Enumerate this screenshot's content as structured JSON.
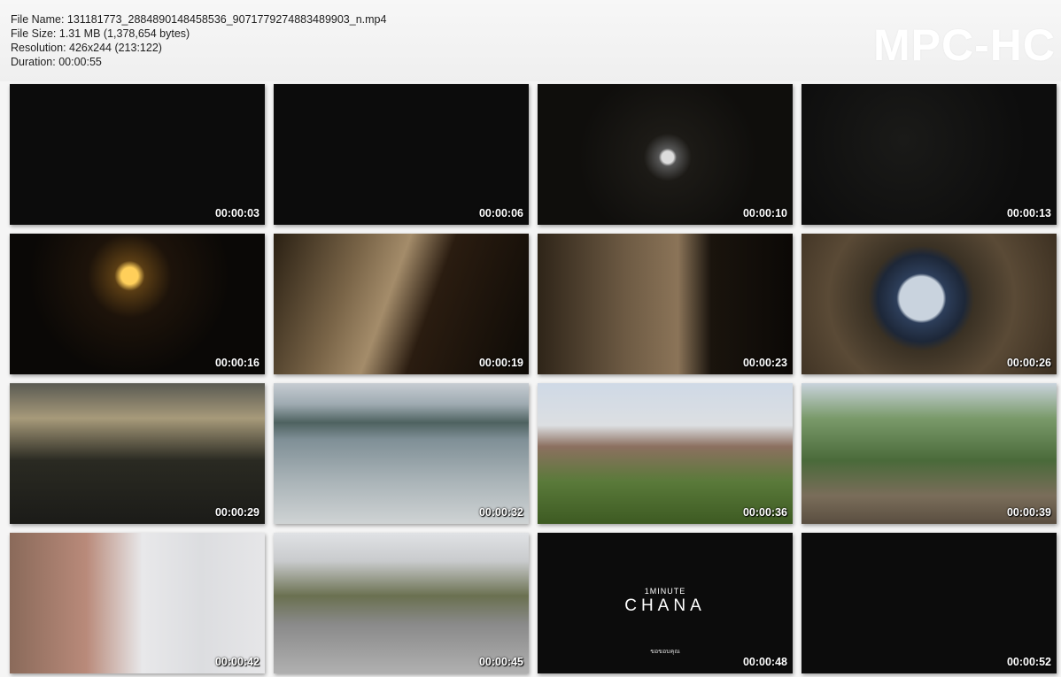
{
  "header": {
    "file_name": "File Name: 131181773_2884890148458536_9071779274883489903_n.mp4",
    "file_size": "File Size: 1.31 MB (1,378,654 bytes)",
    "resolution": "Resolution: 426x244 (213:122)",
    "duration": "Duration: 00:00:55",
    "brand": "MPC-HC"
  },
  "thumbnails": [
    {
      "time": "00:00:03"
    },
    {
      "time": "00:00:06"
    },
    {
      "time": "00:00:10"
    },
    {
      "time": "00:00:13"
    },
    {
      "time": "00:00:16"
    },
    {
      "time": "00:00:19"
    },
    {
      "time": "00:00:23"
    },
    {
      "time": "00:00:26"
    },
    {
      "time": "00:00:29"
    },
    {
      "time": "00:00:32"
    },
    {
      "time": "00:00:36"
    },
    {
      "time": "00:00:39"
    },
    {
      "time": "00:00:42"
    },
    {
      "time": "00:00:45"
    },
    {
      "time": "00:00:48",
      "title_small": "1MINUTE",
      "title_big": "CHANA",
      "caption": "ขอขอบคุณ"
    },
    {
      "time": "00:00:52"
    }
  ]
}
